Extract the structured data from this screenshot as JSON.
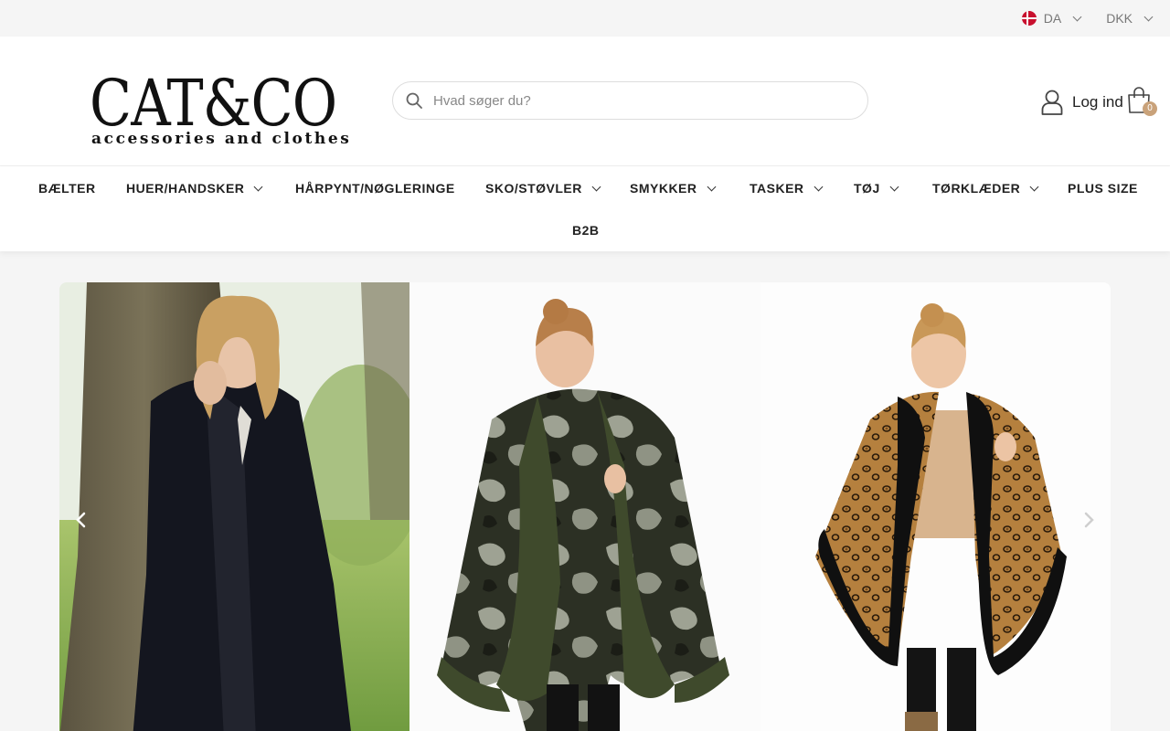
{
  "topbar": {
    "language": "DA",
    "currency": "DKK"
  },
  "header": {
    "logo_main": "CAT&CO",
    "logo_sub": "accessories and clothes",
    "search_placeholder": "Hvad søger du?",
    "login_label": "Log ind",
    "cart_count": "0"
  },
  "nav": {
    "items": [
      {
        "label": "BÆLTER",
        "has_dropdown": false
      },
      {
        "label": "HUER/HANDSKER",
        "has_dropdown": true
      },
      {
        "label": "HÅRPYNT/NØGLERINGE",
        "has_dropdown": false
      },
      {
        "label": "SKO/STØVLER",
        "has_dropdown": true
      },
      {
        "label": "SMYKKER",
        "has_dropdown": true
      },
      {
        "label": "TASKER",
        "has_dropdown": true
      },
      {
        "label": "TØJ",
        "has_dropdown": true
      },
      {
        "label": "TØRKLÆDER",
        "has_dropdown": true
      },
      {
        "label": "PLUS SIZE",
        "has_dropdown": false
      },
      {
        "label": "B2B",
        "has_dropdown": false
      }
    ]
  },
  "slider": {
    "slides": [
      {
        "name": "black-faux-fur-coat-photo"
      },
      {
        "name": "camo-poncho-green-fur-trim-photo"
      },
      {
        "name": "leopard-poncho-black-fur-trim-photo"
      }
    ]
  },
  "colors": {
    "accent": "#c9a27a",
    "flag_red": "#c8102e"
  }
}
